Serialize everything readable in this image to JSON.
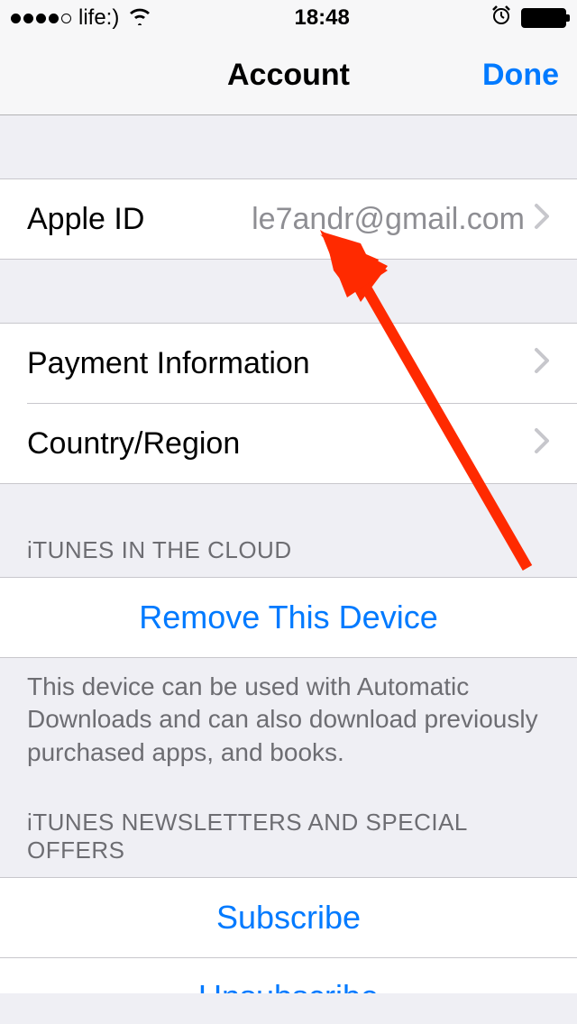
{
  "status": {
    "carrier": "life:)",
    "time": "18:48"
  },
  "nav": {
    "title": "Account",
    "done": "Done"
  },
  "apple_id": {
    "label": "Apple ID",
    "value": "le7andr@gmail.com"
  },
  "rows": {
    "payment": "Payment Information",
    "country": "Country/Region"
  },
  "itunes_cloud": {
    "header": "iTUNES IN THE CLOUD",
    "remove": "Remove This Device",
    "footer": "This device can be used with Automatic Downloads and can also download previously purchased apps, and books."
  },
  "newsletters": {
    "header": "iTUNES NEWSLETTERS AND SPECIAL OFFERS",
    "subscribe": "Subscribe",
    "unsubscribe": "Unsubscribe"
  }
}
